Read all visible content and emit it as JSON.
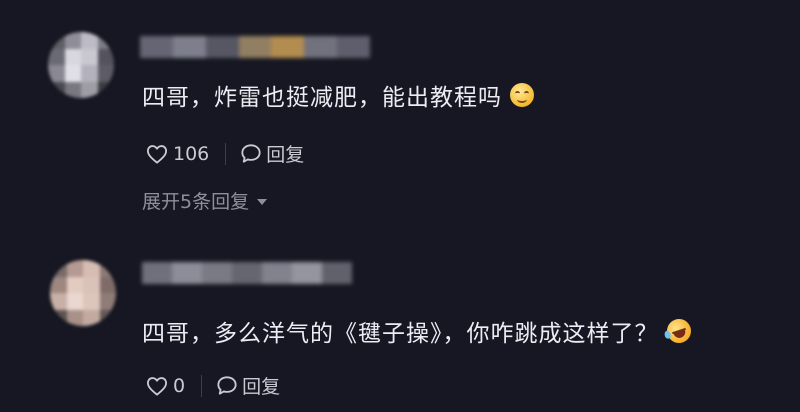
{
  "comments": [
    {
      "text": "四哥，炸雷也挺减肥，能出教程吗",
      "emoji": "smile-emoji",
      "likes": "106",
      "reply_label": "回复",
      "expand_label": "展开5条回复",
      "avatar_colors": [
        "#5e5d66",
        "#8f8d96",
        "#bdbbc4",
        "#7d7c86",
        "#6b6a74",
        "#d8d6de",
        "#c9c7cf",
        "#54535c",
        "#8a8892",
        "#e0dee6",
        "#b3b1ba",
        "#5d5c65",
        "#4a4952",
        "#79777f",
        "#9e9ca5",
        "#3c3b43"
      ],
      "username_colors": [
        "#6e6f7d",
        "#8a8b98",
        "#5d5e6b",
        "#a08a6a",
        "#c49a56",
        "#7b7c88",
        "#666775"
      ]
    },
    {
      "text": "四哥，多么洋气的《毽子操》，你咋跳成这样了？",
      "emoji": "laugh-emoji",
      "likes": "0",
      "reply_label": "回复",
      "avatar_colors": [
        "#7a6a68",
        "#b49a92",
        "#d6bdb3",
        "#8c7a76",
        "#9d8780",
        "#e2cbc1",
        "#d9c2b8",
        "#7f6c69",
        "#c8b0a7",
        "#ead7cf",
        "#dcc5bb",
        "#8f7c77",
        "#5e5452",
        "#a89189",
        "#c2aaa1",
        "#645856"
      ],
      "username_colors": [
        "#7a7a86",
        "#9a9aa6",
        "#85858f",
        "#6f6f7a",
        "#8e8e99",
        "#a3a3ad",
        "#6a6a75"
      ]
    }
  ]
}
